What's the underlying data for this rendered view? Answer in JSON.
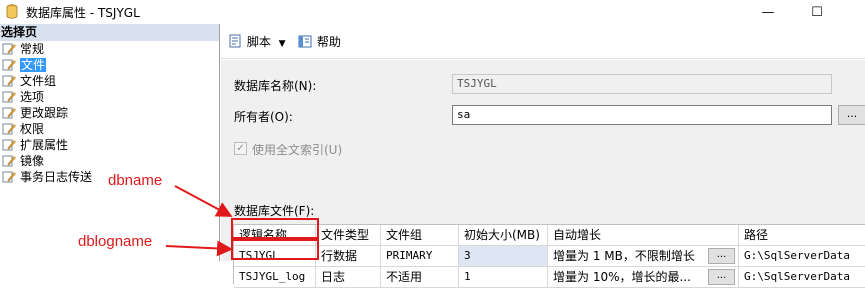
{
  "window": {
    "title": "数据库属性 - TSJYGL",
    "minimize_glyph": "—",
    "maximize_glyph": "☐"
  },
  "sidebar": {
    "header": "选择页",
    "items": [
      {
        "label": "常规",
        "selected": false
      },
      {
        "label": "文件",
        "selected": true
      },
      {
        "label": "文件组",
        "selected": false
      },
      {
        "label": "选项",
        "selected": false
      },
      {
        "label": "更改跟踪",
        "selected": false
      },
      {
        "label": "权限",
        "selected": false
      },
      {
        "label": "扩展属性",
        "selected": false
      },
      {
        "label": "镜像",
        "selected": false
      },
      {
        "label": "事务日志传送",
        "selected": false
      }
    ]
  },
  "toolbar": {
    "script_label": "脚本",
    "help_label": "帮助"
  },
  "form": {
    "dbname_label": "数据库名称(N):",
    "dbname_value": "TSJYGL",
    "owner_label": "所有者(O):",
    "owner_value": "sa",
    "browse_label": "...",
    "fulltext_label": "使用全文索引(U)",
    "fulltext_checked": true,
    "files_label": "数据库文件(F):"
  },
  "grid": {
    "columns": [
      "逻辑名称",
      "文件类型",
      "文件组",
      "初始大小(MB)",
      "自动增长",
      "路径"
    ],
    "rows": [
      {
        "name": "TSJYGL",
        "type": "行数据",
        "group": "PRIMARY",
        "size": "3",
        "growth": "增量为 1 MB，不限制增长",
        "path": "G:\\SqlServerData"
      },
      {
        "name": "TSJYGL_log",
        "type": "日志",
        "group": "不适用",
        "size": "1",
        "growth": "增量为 10%，增长的最...",
        "path": "G:\\SqlServerData"
      }
    ]
  },
  "annotations": {
    "dbname": "dbname",
    "dblogname": "dblogname",
    "color": "#e0191c"
  },
  "colors": {
    "selection": "#3399ff",
    "sidebar_header": "#d8e1ee"
  }
}
